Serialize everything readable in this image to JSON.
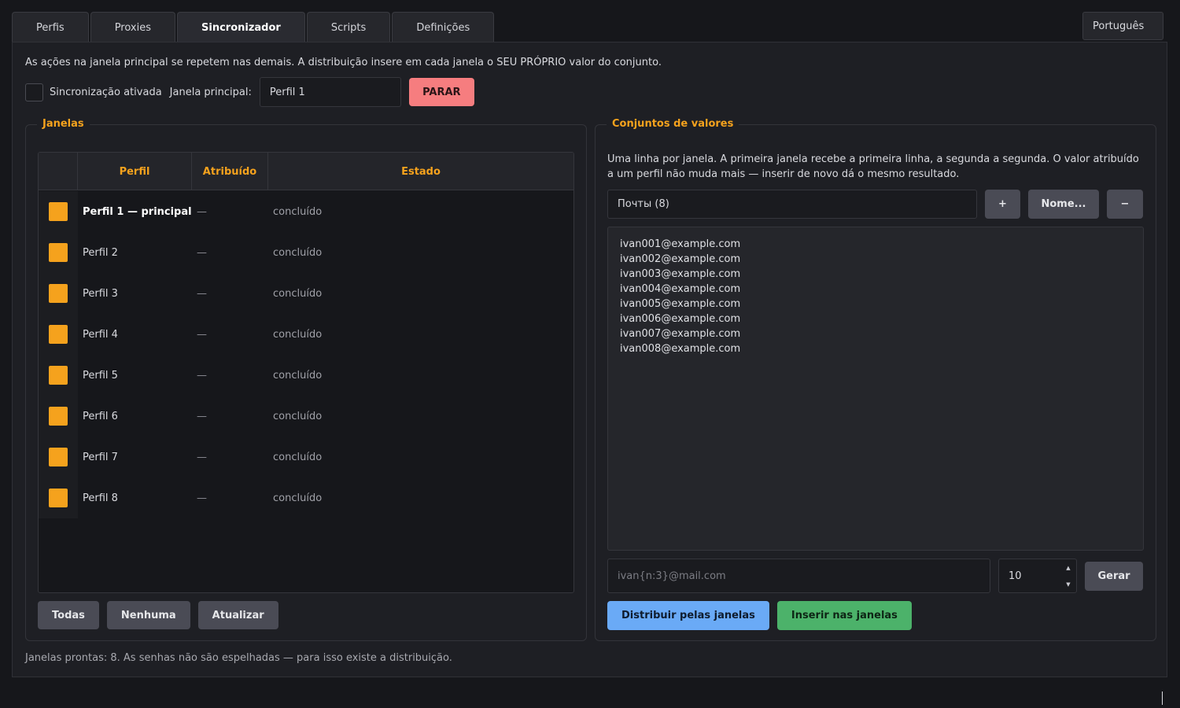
{
  "tabs": [
    {
      "label": "Perfis"
    },
    {
      "label": "Proxies"
    },
    {
      "label": "Sincronizador",
      "active": true
    },
    {
      "label": "Scripts"
    },
    {
      "label": "Definições"
    }
  ],
  "language": "Português",
  "sync": {
    "intro": "As ações na janela principal se repetem nas demais. A distribuição insere em cada janela o SEU PRÓPRIO valor do conjunto.",
    "enabled_label": "Sincronização ativada",
    "enabled": false,
    "principal_label": "Janela principal:",
    "principal_value": "Perfil 1",
    "stop_button": "PARAR"
  },
  "windows": {
    "title": "Janelas",
    "columns": [
      "Perfil",
      "Atribuído",
      "Estado"
    ],
    "rows": [
      {
        "name": "Perfil 1  — principal",
        "assigned": "—",
        "state": "concluído"
      },
      {
        "name": "Perfil 2",
        "assigned": "—",
        "state": "concluído"
      },
      {
        "name": "Perfil 3",
        "assigned": "—",
        "state": "concluído"
      },
      {
        "name": "Perfil 4",
        "assigned": "—",
        "state": "concluído"
      },
      {
        "name": "Perfil 5",
        "assigned": "—",
        "state": "concluído"
      },
      {
        "name": "Perfil 6",
        "assigned": "—",
        "state": "concluído"
      },
      {
        "name": "Perfil 7",
        "assigned": "—",
        "state": "concluído"
      },
      {
        "name": "Perfil 8",
        "assigned": "—",
        "state": "concluído"
      }
    ],
    "buttons": {
      "all": "Todas",
      "none": "Nenhuma",
      "refresh": "Atualizar"
    }
  },
  "value_sets": {
    "title": "Conjuntos de valores",
    "description": "Uma linha por janela. A primeira janela recebe a primeira linha, a segunda a segunda. O valor atribuído a um perfil não muda mais — inserir de novo dá o mesmo resultado.",
    "selected_set": "Почты (8)",
    "add_button": "+",
    "rename_button": "Nome...",
    "remove_button": "−",
    "lines": [
      "ivan001@example.com",
      "ivan002@example.com",
      "ivan003@example.com",
      "ivan004@example.com",
      "ivan005@example.com",
      "ivan006@example.com",
      "ivan007@example.com",
      "ivan008@example.com"
    ],
    "pattern_placeholder": "ivan{n:3}@mail.com",
    "count": "10",
    "generate_button": "Gerar",
    "distribute_button": "Distribuir pelas janelas",
    "insert_button": "Inserir nas janelas"
  },
  "footer_note": "Janelas prontas: 8. As senhas não são espelhadas — para isso existe a distribuição."
}
